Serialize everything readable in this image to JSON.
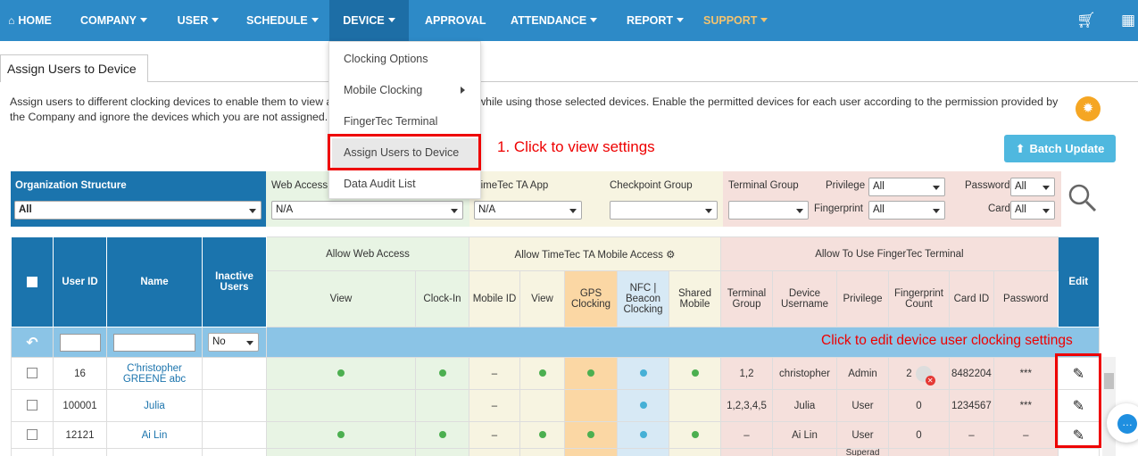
{
  "nav": {
    "home": "HOME",
    "company": "COMPANY",
    "user": "USER",
    "schedule": "SCHEDULE",
    "device": "DEVICE",
    "approval": "APPROVAL",
    "attendance": "ATTENDANCE",
    "report": "REPORT",
    "support": "SUPPORT"
  },
  "tab": {
    "title": "Assign Users to Device"
  },
  "description": "Assign users to different clocking devices to enable them to view and clock-in/out to TimeTec TA while using those selected devices. Enable the permitted devices for each user according to the permission provided by the Company and ignore the devices which you are not assigned.",
  "batch_update": "Batch Update",
  "filters": {
    "org_label": "Organization Structure",
    "org_value": "All",
    "web_label": "Web Access",
    "web_value": "N/A",
    "app_label": "TimeTec TA App",
    "app_value": "N/A",
    "checkpoint_label": "Checkpoint Group",
    "checkpoint_value": "",
    "terminal_label": "Terminal Group",
    "terminal_value": "",
    "privilege_label": "Privilege",
    "privilege_value": "All",
    "fingerprint_label": "Fingerprint",
    "fingerprint_value": "All",
    "password_label": "Password",
    "password_value": "All",
    "card_label": "Card",
    "card_value": "All"
  },
  "table": {
    "headers": {
      "user_id": "User ID",
      "name": "Name",
      "inactive": "Inactive Users",
      "allow_web": "Allow Web Access",
      "allow_mobile": "Allow TimeTec TA Mobile Access",
      "allow_terminal": "Allow To Use FingerTec Terminal",
      "edit": "Edit",
      "view": "View",
      "clock_in": "Clock-In",
      "mobile_id": "Mobile ID",
      "view2": "View",
      "gps": "GPS Clocking",
      "nfc": "NFC | Beacon Clocking",
      "shared": "Shared Mobile",
      "term_group": "Terminal Group",
      "device_user": "Device Username",
      "privilege": "Privilege",
      "fp_count": "Fingerprint Count",
      "card_id": "Card ID",
      "password": "Password"
    },
    "inactive_filter": "No",
    "rows": [
      {
        "id": "16",
        "name": "C'hristopher GREENE abc",
        "mobile_id": "–",
        "group": "1,2",
        "dev_user": "christopher",
        "priv": "Admin",
        "fp": "2",
        "card": "8482204",
        "pwd": "***"
      },
      {
        "id": "100001",
        "name": "Julia",
        "mobile_id": "–",
        "group": "1,2,3,4,5",
        "dev_user": "Julia",
        "priv": "User",
        "fp": "0",
        "card": "1234567",
        "pwd": "***"
      },
      {
        "id": "12121",
        "name": "Ai Lin",
        "mobile_id": "–",
        "group": "–",
        "dev_user": "Ai Lin",
        "priv": "User",
        "fp": "0",
        "card": "–",
        "pwd": "–"
      }
    ],
    "partial_row_priv": "Superad"
  },
  "dropdown": {
    "items": [
      "Clocking Options",
      "Mobile Clocking",
      "FingerTec Terminal",
      "Assign Users to Device",
      "Data Audit List"
    ]
  },
  "annotations": {
    "step1": "1. Click to view settings",
    "edit": "Click to edit device user clocking settings"
  },
  "colors": {
    "nav": "#2d8ac7",
    "header": "#1b74ad",
    "accent_red": "#ee0000"
  }
}
